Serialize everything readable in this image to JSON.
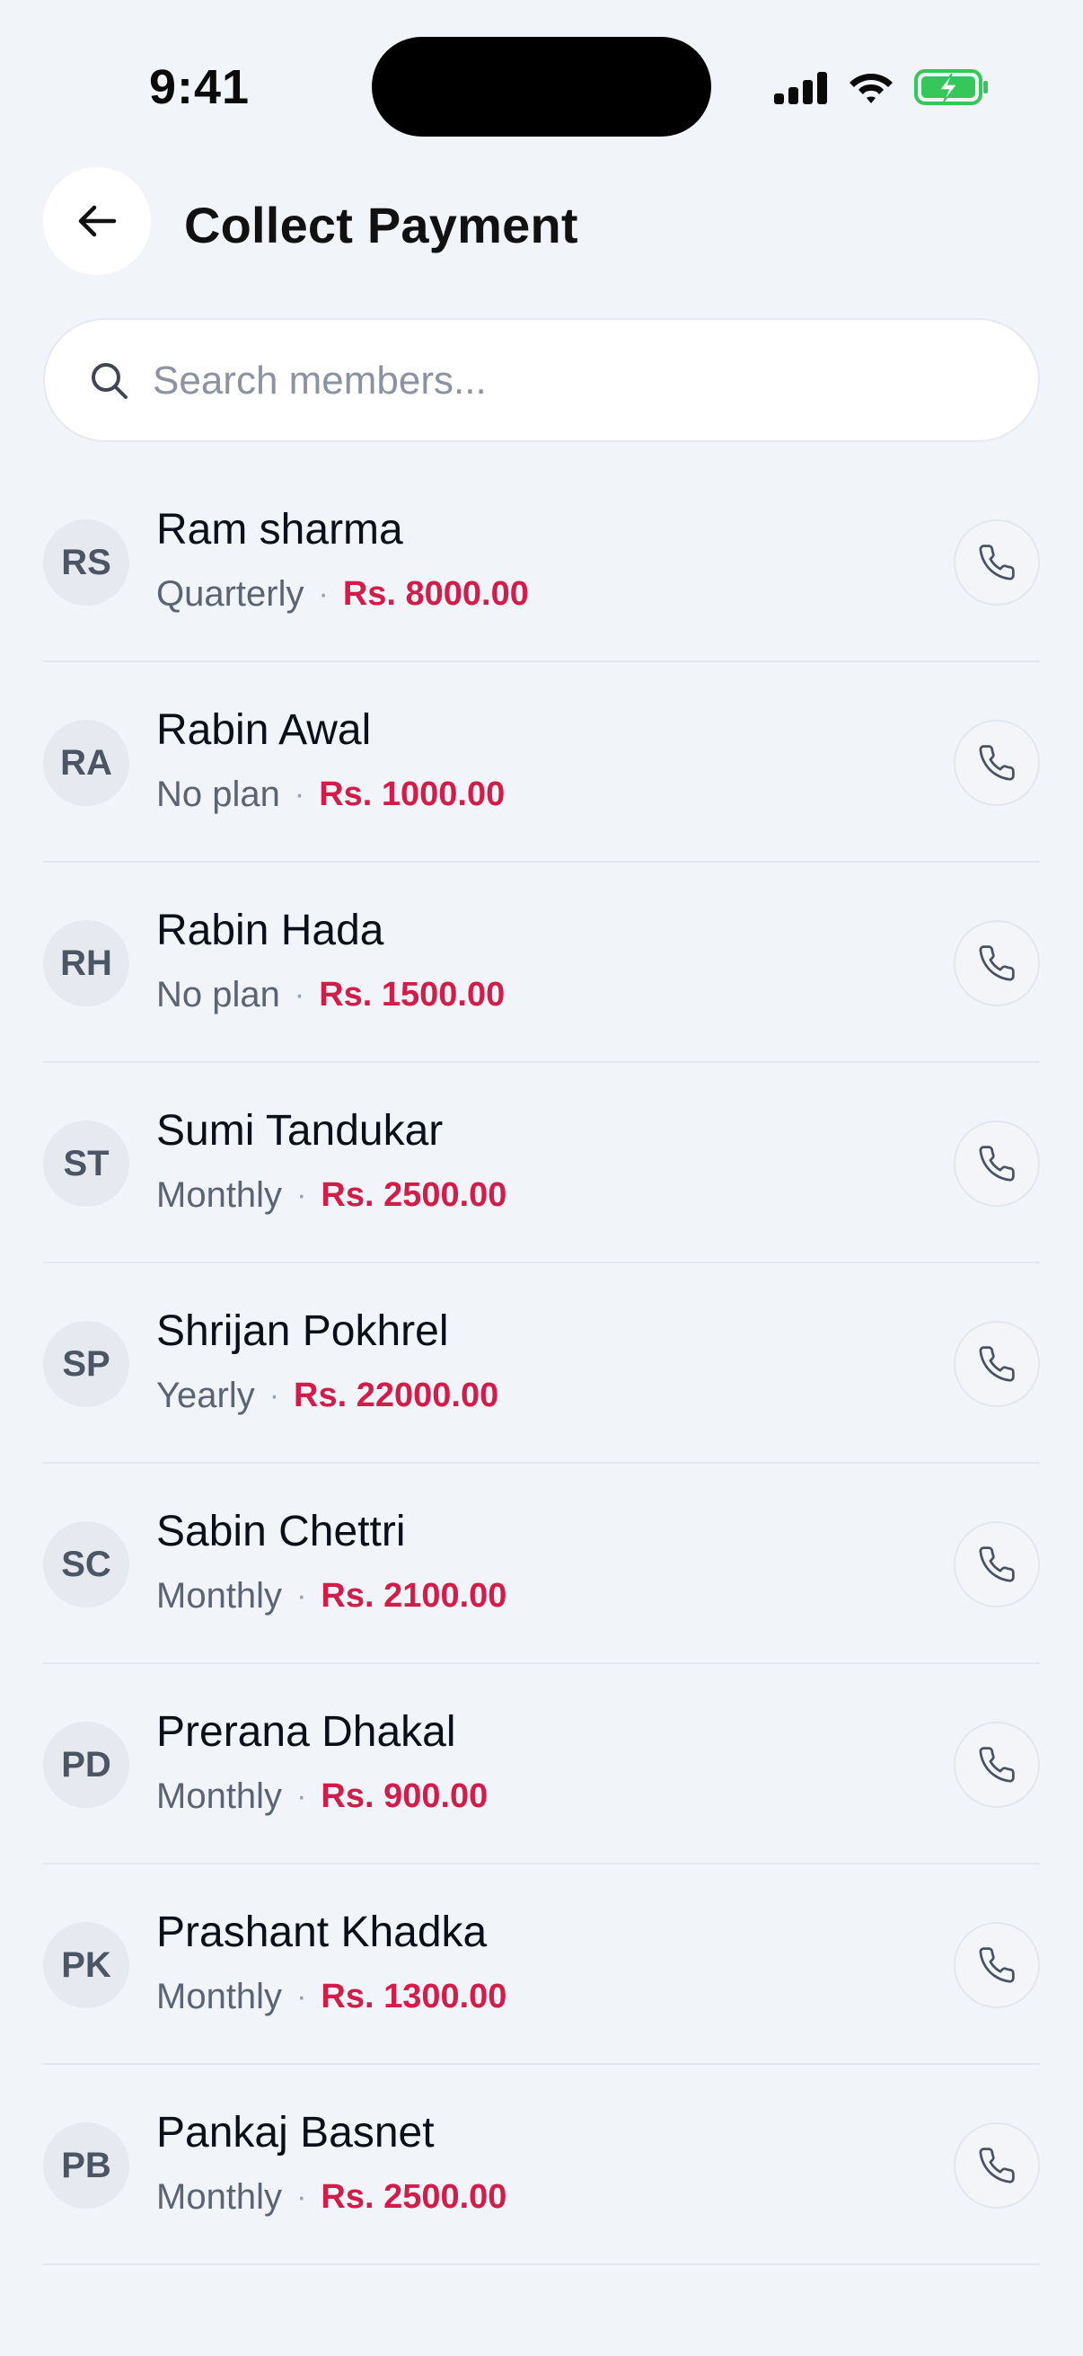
{
  "status_bar": {
    "time": "9:41",
    "icons": [
      "cellular-signal-icon",
      "wifi-icon",
      "battery-charging-icon"
    ],
    "battery_color": "#34c759"
  },
  "header": {
    "back_icon": "arrow-left-icon",
    "title": "Collect Payment"
  },
  "search": {
    "icon": "search-icon",
    "placeholder": "Search members...",
    "value": ""
  },
  "colors": {
    "background": "#f1f4f9",
    "amount": "#d21d4a",
    "avatar_bg": "#e6eaf0"
  },
  "members": [
    {
      "initials": "RS",
      "name": "Ram sharma",
      "plan": "Quarterly",
      "amount": "Rs. 8000.00"
    },
    {
      "initials": "RA",
      "name": "Rabin Awal",
      "plan": "No plan",
      "amount": "Rs. 1000.00"
    },
    {
      "initials": "RH",
      "name": "Rabin Hada",
      "plan": "No plan",
      "amount": "Rs. 1500.00"
    },
    {
      "initials": "ST",
      "name": "Sumi Tandukar",
      "plan": "Monthly",
      "amount": "Rs. 2500.00"
    },
    {
      "initials": "SP",
      "name": "Shrijan Pokhrel",
      "plan": "Yearly",
      "amount": "Rs. 22000.00"
    },
    {
      "initials": "SC",
      "name": "Sabin Chettri",
      "plan": "Monthly",
      "amount": "Rs. 2100.00"
    },
    {
      "initials": "PD",
      "name": "Prerana Dhakal",
      "plan": "Monthly",
      "amount": "Rs. 900.00"
    },
    {
      "initials": "PK",
      "name": "Prashant Khadka",
      "plan": "Monthly",
      "amount": "Rs. 1300.00"
    },
    {
      "initials": "PB",
      "name": "Pankaj Basnet",
      "plan": "Monthly",
      "amount": "Rs. 2500.00"
    }
  ],
  "separator": "·",
  "row_icon": "phone-icon"
}
